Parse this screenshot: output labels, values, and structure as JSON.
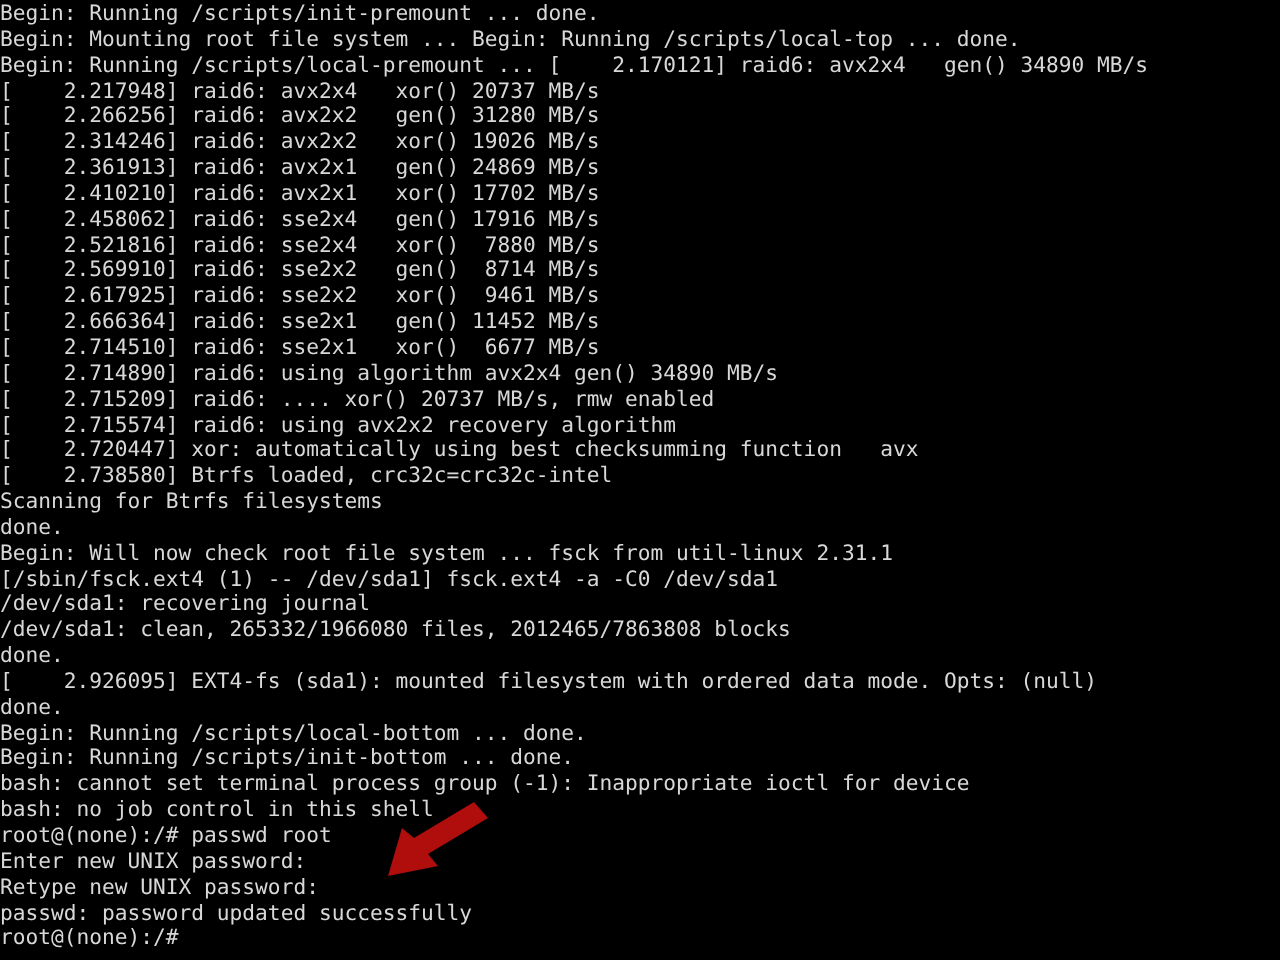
{
  "terminal": {
    "lines": [
      "Begin: Running /scripts/init-premount ... done.",
      "Begin: Mounting root file system ... Begin: Running /scripts/local-top ... done.",
      "Begin: Running /scripts/local-premount ... [    2.170121] raid6: avx2x4   gen() 34890 MB/s",
      "[    2.217948] raid6: avx2x4   xor() 20737 MB/s",
      "[    2.266256] raid6: avx2x2   gen() 31280 MB/s",
      "[    2.314246] raid6: avx2x2   xor() 19026 MB/s",
      "[    2.361913] raid6: avx2x1   gen() 24869 MB/s",
      "[    2.410210] raid6: avx2x1   xor() 17702 MB/s",
      "[    2.458062] raid6: sse2x4   gen() 17916 MB/s",
      "[    2.521816] raid6: sse2x4   xor()  7880 MB/s",
      "[    2.569910] raid6: sse2x2   gen()  8714 MB/s",
      "[    2.617925] raid6: sse2x2   xor()  9461 MB/s",
      "[    2.666364] raid6: sse2x1   gen() 11452 MB/s",
      "[    2.714510] raid6: sse2x1   xor()  6677 MB/s",
      "[    2.714890] raid6: using algorithm avx2x4 gen() 34890 MB/s",
      "[    2.715209] raid6: .... xor() 20737 MB/s, rmw enabled",
      "[    2.715574] raid6: using avx2x2 recovery algorithm",
      "[    2.720447] xor: automatically using best checksumming function   avx",
      "[    2.738580] Btrfs loaded, crc32c=crc32c-intel",
      "Scanning for Btrfs filesystems",
      "done.",
      "Begin: Will now check root file system ... fsck from util-linux 2.31.1",
      "[/sbin/fsck.ext4 (1) -- /dev/sda1] fsck.ext4 -a -C0 /dev/sda1",
      "/dev/sda1: recovering journal",
      "/dev/sda1: clean, 265332/1966080 files, 2012465/7863808 blocks",
      "done.",
      "[    2.926095] EXT4-fs (sda1): mounted filesystem with ordered data mode. Opts: (null)",
      "done.",
      "Begin: Running /scripts/local-bottom ... done.",
      "Begin: Running /scripts/init-bottom ... done.",
      "bash: cannot set terminal process group (-1): Inappropriate ioctl for device",
      "bash: no job control in this shell",
      "root@(none):/# passwd root",
      "Enter new UNIX password:",
      "Retype new UNIX password:",
      "passwd: password updated successfully",
      "root@(none):/#"
    ]
  }
}
